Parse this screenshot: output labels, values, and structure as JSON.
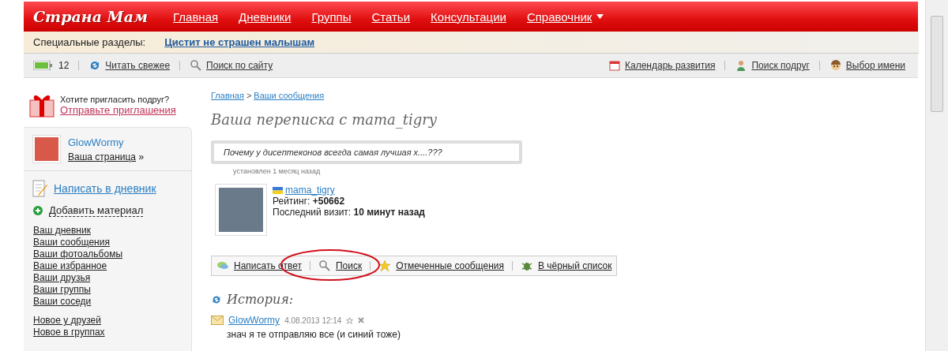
{
  "header": {
    "logo": "Страна Мам",
    "nav": [
      {
        "label": "Главная",
        "dropdown": false
      },
      {
        "label": "Дневники",
        "dropdown": false
      },
      {
        "label": "Группы",
        "dropdown": false
      },
      {
        "label": "Статьи",
        "dropdown": false
      },
      {
        "label": "Консультации",
        "dropdown": false
      },
      {
        "label": "Справочник",
        "dropdown": true
      }
    ]
  },
  "special": {
    "label": "Специальные разделы:",
    "link": "Цистит не страшен малышам"
  },
  "toolbar": {
    "count": "12",
    "left": [
      {
        "kind": "refresh",
        "label": "Читать свежее"
      },
      {
        "kind": "search",
        "label": "Поиск по сайту"
      }
    ],
    "right": [
      {
        "kind": "calendar",
        "label": "Календарь развития"
      },
      {
        "kind": "person",
        "label": "Поиск подруг"
      },
      {
        "kind": "face",
        "label": "Выбор имени"
      }
    ]
  },
  "sidebar": {
    "invite_question": "Хотите пригласить подруг?",
    "invite_link": "Отправьте приглашения",
    "user": {
      "name": "GlowWormy",
      "page_link": "Ваша страница",
      "page_suffix": "»"
    },
    "write_link": "Написать в дневник",
    "add_material": "Добавить материал",
    "links": [
      "Ваш дневник",
      "Ваши сообщения",
      "Ваши фотоальбомы",
      "Ваше избранное",
      "Ваши друзья",
      "Ваши группы",
      "Ваши соседи"
    ],
    "links_2": [
      "Новое у друзей",
      "Новое в группах"
    ]
  },
  "breadcrumb": [
    {
      "label": "Главная"
    },
    {
      "label": "Ваши сообщения"
    }
  ],
  "breadcrumb_separator": ">",
  "title": "Ваша переписка с mama_tigry",
  "status": {
    "text": "Почему у дисептеконов всегда самая лучшая х....???",
    "time": "установлен 1 месяц назад"
  },
  "profile": {
    "name": "mama_tigry",
    "rating_label": "Рейтинг:",
    "rating": "+50662",
    "visit_label": "Последний визит:",
    "visit": "10 минут назад"
  },
  "actions": [
    {
      "kind": "reply",
      "label": "Написать ответ",
      "highlighted": false
    },
    {
      "kind": "search",
      "label": "Поиск",
      "highlighted": true
    },
    {
      "kind": "star",
      "label": "Отмеченные сообщения",
      "highlighted": false
    },
    {
      "kind": "bug",
      "label": "В чёрный список",
      "highlighted": false
    }
  ],
  "history": {
    "title": "История:",
    "messages": [
      {
        "author": "GlowWormy",
        "date": "4.08.2013 12:14",
        "text": "знач я те отправляю все (и синий тоже)"
      }
    ]
  }
}
